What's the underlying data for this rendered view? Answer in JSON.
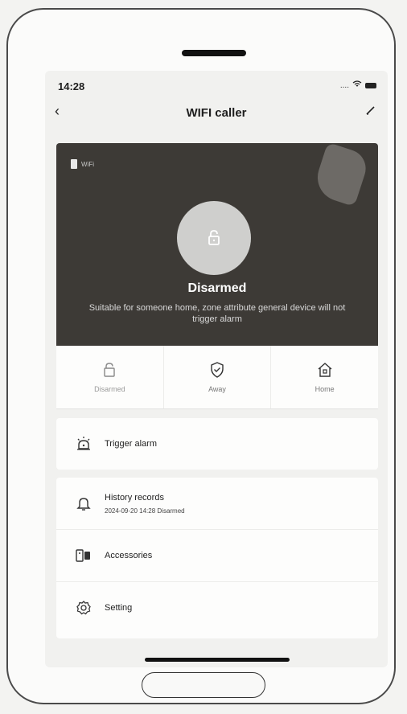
{
  "status": {
    "time": "14:28",
    "extra": "...."
  },
  "header": {
    "title": "WIFI caller"
  },
  "device": {
    "tag": "WiFi"
  },
  "hero": {
    "state": "Disarmed",
    "description": "Suitable for someone home, zone attribute general device will not trigger alarm"
  },
  "modes": [
    {
      "label": "Disarmed"
    },
    {
      "label": "Away"
    },
    {
      "label": "Home"
    }
  ],
  "menu": {
    "trigger": "Trigger alarm",
    "history": {
      "title": "History records",
      "detail": "2024-09-20 14:28 Disarmed"
    },
    "accessories": "Accessories",
    "setting": "Setting"
  }
}
